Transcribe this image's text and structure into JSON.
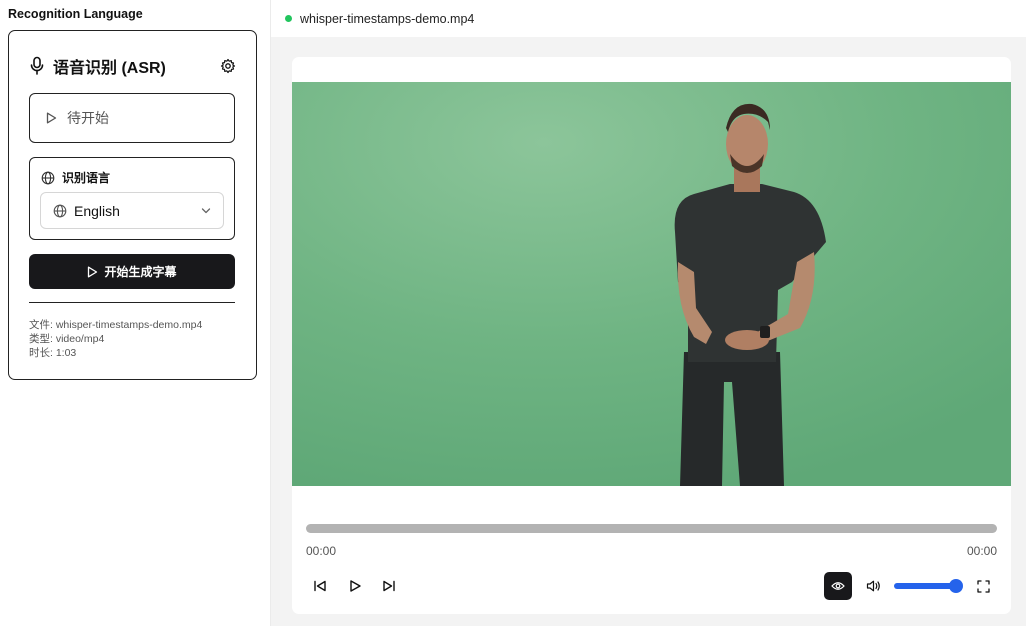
{
  "left": {
    "heading": "Recognition Language",
    "card": {
      "title": "语音识别 (ASR)",
      "status": "待开始",
      "language_section_label": "识别语言",
      "language_value": "English",
      "start_button": "开始生成字幕",
      "meta": {
        "file": "文件: whisper-timestamps-demo.mp4",
        "type": "类型: video/mp4",
        "duration": "时长: 1:03"
      }
    }
  },
  "right": {
    "file_name": "whisper-timestamps-demo.mp4",
    "status_color": "#22c55e",
    "player": {
      "current_time": "00:00",
      "total_time": "00:00",
      "progress": 0,
      "volume": 1.0,
      "accent_color": "#2563eb",
      "icons": [
        "skip-back-icon",
        "play-icon",
        "skip-forward-icon",
        "eye-icon",
        "volume-icon",
        "fullscreen-icon"
      ]
    }
  }
}
